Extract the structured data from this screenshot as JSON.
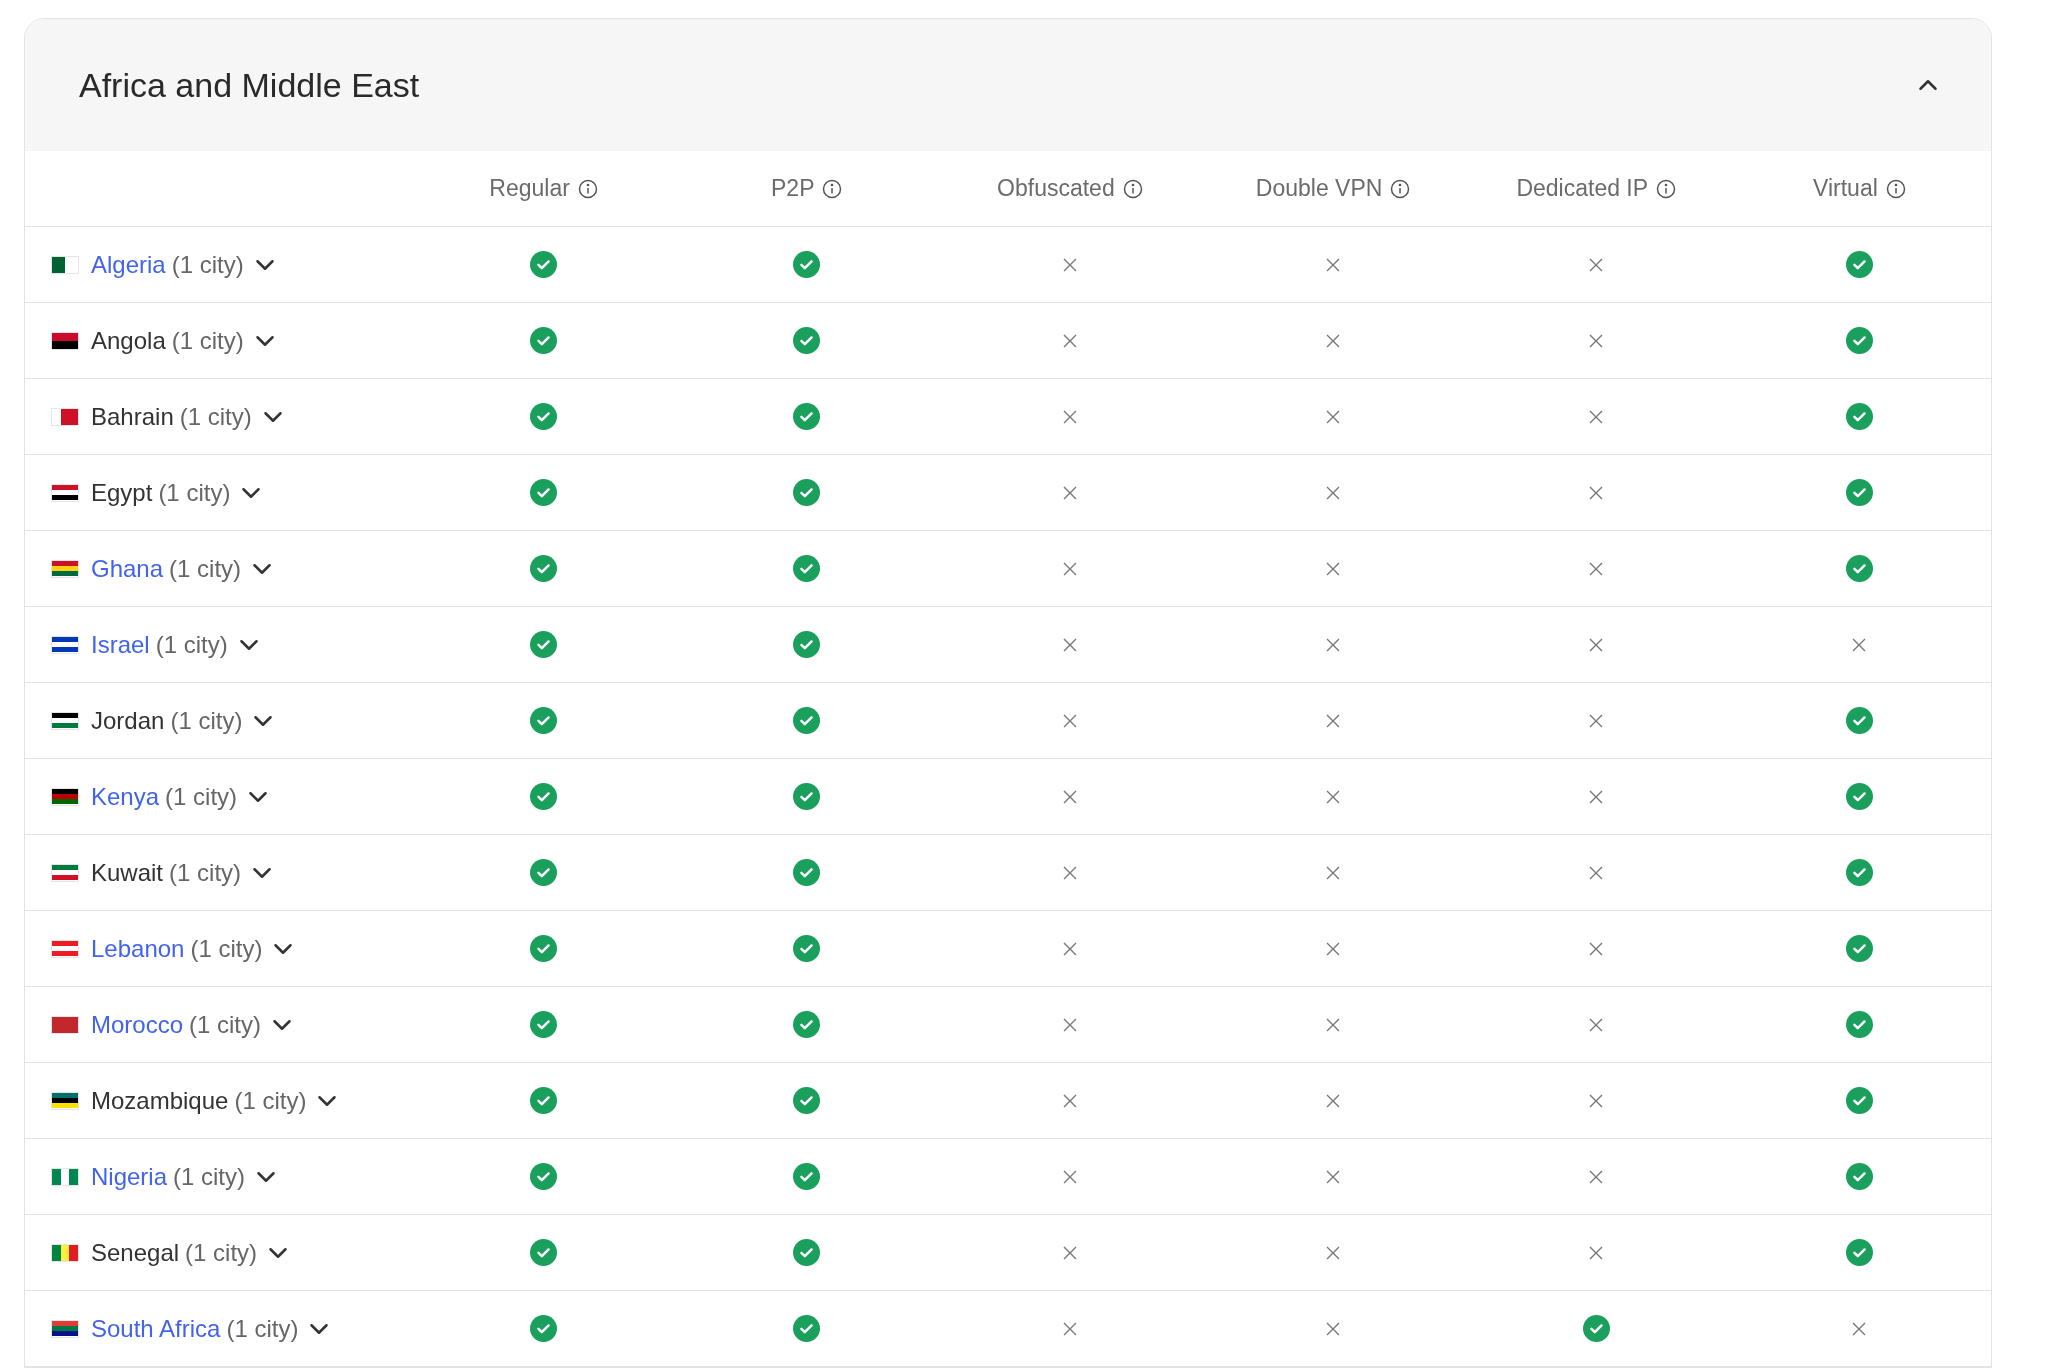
{
  "region": {
    "title": "Africa and Middle East",
    "expanded": true
  },
  "columns": [
    "Regular",
    "P2P",
    "Obfuscated",
    "Double VPN",
    "Dedicated IP",
    "Virtual"
  ],
  "rows": [
    {
      "country": "Algeria",
      "cities": "(1 city)",
      "linked": true,
      "expanded": false,
      "supported": [
        true,
        true,
        false,
        false,
        false,
        true
      ]
    },
    {
      "country": "Angola",
      "cities": "(1 city)",
      "linked": false,
      "expanded": false,
      "supported": [
        true,
        true,
        false,
        false,
        false,
        true
      ]
    },
    {
      "country": "Bahrain",
      "cities": "(1 city)",
      "linked": false,
      "expanded": false,
      "supported": [
        true,
        true,
        false,
        false,
        false,
        true
      ]
    },
    {
      "country": "Egypt",
      "cities": "(1 city)",
      "linked": false,
      "expanded": false,
      "supported": [
        true,
        true,
        false,
        false,
        false,
        true
      ]
    },
    {
      "country": "Ghana",
      "cities": "(1 city)",
      "linked": true,
      "expanded": false,
      "supported": [
        true,
        true,
        false,
        false,
        false,
        true
      ]
    },
    {
      "country": "Israel",
      "cities": "(1 city)",
      "linked": true,
      "expanded": false,
      "supported": [
        true,
        true,
        false,
        false,
        false,
        false
      ]
    },
    {
      "country": "Jordan",
      "cities": "(1 city)",
      "linked": false,
      "expanded": false,
      "supported": [
        true,
        true,
        false,
        false,
        false,
        true
      ]
    },
    {
      "country": "Kenya",
      "cities": "(1 city)",
      "linked": true,
      "expanded": false,
      "supported": [
        true,
        true,
        false,
        false,
        false,
        true
      ]
    },
    {
      "country": "Kuwait",
      "cities": "(1 city)",
      "linked": false,
      "expanded": false,
      "supported": [
        true,
        true,
        false,
        false,
        false,
        true
      ]
    },
    {
      "country": "Lebanon",
      "cities": "(1 city)",
      "linked": true,
      "expanded": false,
      "supported": [
        true,
        true,
        false,
        false,
        false,
        true
      ]
    },
    {
      "country": "Morocco",
      "cities": "(1 city)",
      "linked": true,
      "expanded": false,
      "supported": [
        true,
        true,
        false,
        false,
        false,
        true
      ]
    },
    {
      "country": "Mozambique",
      "cities": "(1 city)",
      "linked": false,
      "expanded": false,
      "supported": [
        true,
        true,
        false,
        false,
        false,
        true
      ]
    },
    {
      "country": "Nigeria",
      "cities": "(1 city)",
      "linked": true,
      "expanded": false,
      "supported": [
        true,
        true,
        false,
        false,
        false,
        true
      ]
    },
    {
      "country": "Senegal",
      "cities": "(1 city)",
      "linked": false,
      "expanded": false,
      "supported": [
        true,
        true,
        false,
        false,
        false,
        true
      ]
    },
    {
      "country": "South Africa",
      "cities": "(1 city)",
      "linked": true,
      "expanded": false,
      "supported": [
        true,
        true,
        false,
        false,
        true,
        false
      ]
    }
  ]
}
